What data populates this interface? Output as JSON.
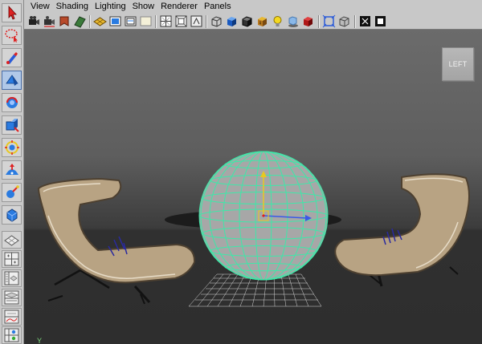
{
  "menu": {
    "view": "View",
    "shading": "Shading",
    "lighting": "Lighting",
    "show": "Show",
    "renderer": "Renderer",
    "panels": "Panels"
  },
  "viewport": {
    "view_cube_label": "LEFT",
    "axis_label": "Y"
  },
  "colors": {
    "wireframe": "#3ee8a8",
    "chair": "#b8a383",
    "background_top": "#6b6b6b",
    "floor": "#2f2f2f"
  },
  "icons": {
    "toolbox": [
      "select-icon",
      "lasso-icon",
      "paint-select-icon",
      "move-icon",
      "rotate-icon",
      "scale-icon",
      "universal-manipulator-icon",
      "soft-modify-icon",
      "show-manipulator-icon",
      "last-tool-icon"
    ],
    "layouts": [
      "single-perspective-layout-icon",
      "four-view-layout-icon",
      "persp-outliner-layout-icon",
      "outliner-icon",
      "graph-editor-layout-icon",
      "hypershade-layout-icon"
    ]
  }
}
